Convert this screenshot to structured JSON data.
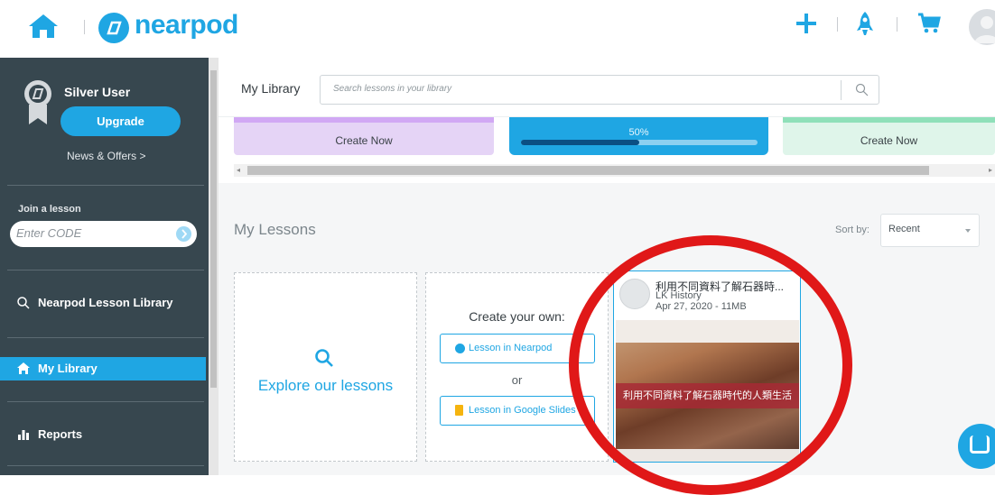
{
  "header": {
    "logo_text": "nearpod"
  },
  "sidebar": {
    "user_name": "Silver User",
    "upgrade_label": "Upgrade",
    "news_label": "News & Offers >",
    "join_label": "Join a lesson",
    "code_placeholder": "Enter CODE",
    "nav": [
      {
        "label": "Nearpod Lesson Library"
      },
      {
        "label": "My Library"
      },
      {
        "label": "Reports"
      }
    ]
  },
  "library": {
    "title": "My Library",
    "search_placeholder": "Search lessons in your library"
  },
  "create_cards": {
    "purple_label": "Create Now",
    "blue_percent": "50%",
    "blue_progress": 0.5,
    "green_label": "Create Now"
  },
  "lessons": {
    "title": "My Lessons",
    "sort_label": "Sort by:",
    "sort_value": "Recent",
    "explore_label": "Explore our lessons",
    "create_own_label": "Create your own:",
    "nearpod_option": "Lesson in Nearpod",
    "or_label": "or",
    "slides_option": "Lesson in Google Slides"
  },
  "lesson_card": {
    "title": "利用不同資料了解石器時...",
    "owner": "LK History",
    "meta": "Apr 27, 2020 - 11MB",
    "banner": "利用不同資料了解石器時代的人類生活"
  },
  "colors": {
    "accent": "#1fa6e3",
    "sidebar": "#37474f",
    "highlight_ring": "#e01818"
  }
}
